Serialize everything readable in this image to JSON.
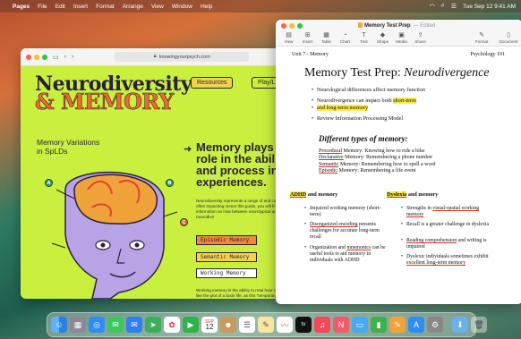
{
  "menubar": {
    "apple": "",
    "items": [
      "Pages",
      "File",
      "Edit",
      "Insert",
      "Format",
      "Arrange",
      "View",
      "Window",
      "Help"
    ],
    "clock": "Tue Sep 12  9:41 AM"
  },
  "browser": {
    "url": "knowingyourpsych.com",
    "logo_line1": "Neurodiversity",
    "logo_line2": "& MEMORY",
    "nav": [
      "Resources",
      "Play/L"
    ],
    "subtitle_line1": "Memory Variations",
    "subtitle_line2": "in SpLDs",
    "headline": "Memory plays a role in the ability and process info experiences.",
    "body1": "Neurodiversity represents a range of and cognition, often impacting memo this guide, you will find information on how between neurotypical and neurodive",
    "buttons": {
      "episodic": "Episodic Memory",
      "semantic": "Semantic Memory",
      "working": "Working Memory"
    },
    "body2": "Working memory is the ability to retai hour or less, like the plot of a book life, as this \"temporary storage\" is ne instructions, and store names and fac",
    "markers": {
      "a": "A",
      "b": "B",
      "c": "C"
    }
  },
  "pages": {
    "doc_title": "Memory Test Prep",
    "edited": "— Edited",
    "toolbar_left": [
      "View",
      "Insert",
      "Table",
      "Chart",
      "Text",
      "Shape",
      "Media",
      "Share"
    ],
    "toolbar_right": [
      "Format",
      "Document"
    ],
    "header_left": "Unit 7 - Memory",
    "header_right": "Psychology 101",
    "title_plain": "Memory Test Prep: ",
    "title_italic": "Neurodivergence",
    "bullets": {
      "b1": "Neurological differences affect memory function",
      "b2a": "Neurodivergence can impact both ",
      "b2b": "short-term",
      "b2c": "and long-term memory",
      "b3": "Review Information Processing Model"
    },
    "types_heading": "Different types of memory:",
    "types": [
      {
        "term": "Procedural",
        "desc": " Memory: Knowing how to ride a bike"
      },
      {
        "term": "Declarative",
        "desc": " Memory: Remembering a phone number"
      },
      {
        "term": "Semantic",
        "desc": " Memory: Remembering how to spell a word"
      },
      {
        "term": "Episodic",
        "desc": " Memory: Remembering a life event"
      }
    ],
    "adhd_heading_a": "ADHD",
    "adhd_heading_b": " and memory",
    "dyslexia_heading_a": "Dyslexia",
    "dyslexia_heading_b": " and memory",
    "adhd_items": {
      "i1": "Impaired working memory (short-term)",
      "i2a": "Disorganized encoding",
      "i2b": " presents challenges for accurate long-term recall",
      "i3a": "Organization and ",
      "i3b": "mnemonics",
      "i3c": " can be useful tools to aid memory in individuals with ADHD"
    },
    "dyslexia_items": {
      "i1a": "Strengths in ",
      "i1b": "visual-spatial working memory",
      "i2": "Recall is a greater challenge in dyslexia",
      "i3a": "Reading comprehension",
      "i3b": " and writing is impaired",
      "i4a": "Dyslexic individuals sometimes exhibit ",
      "i4b": "excellent long-term memory"
    }
  },
  "dock": {
    "calendar_month": "SEP",
    "calendar_day": "12"
  },
  "colors": {
    "site_bg": "#c9f03e",
    "highlight": "#fbea4a",
    "accent_orange": "#f06a2a"
  }
}
